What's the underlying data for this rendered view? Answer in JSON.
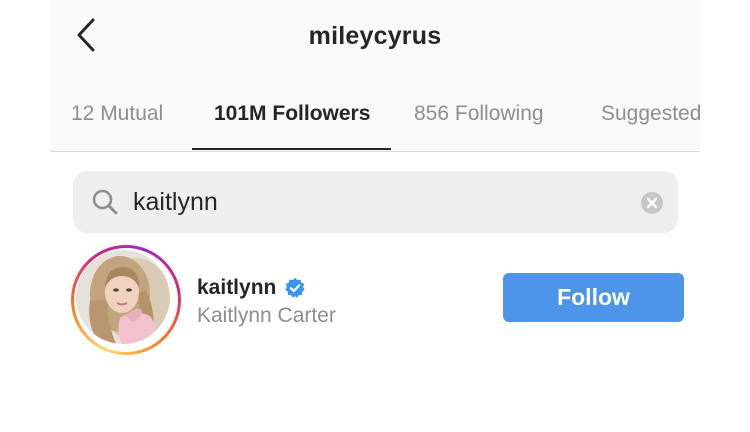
{
  "header": {
    "title": "mileycyrus",
    "back_icon": "chevron-left-icon"
  },
  "tabs": [
    {
      "label": "12 Mutual",
      "active": false
    },
    {
      "label": "101M Followers",
      "active": true
    },
    {
      "label": "856 Following",
      "active": false
    },
    {
      "label": "Suggested",
      "active": false
    }
  ],
  "search": {
    "value": "kaitlynn",
    "icon": "search-icon",
    "clear_icon": "clear-icon"
  },
  "results": [
    {
      "username": "kaitlynn",
      "full_name": "Kaitlynn Carter",
      "verified": true,
      "follow_label": "Follow"
    }
  ],
  "colors": {
    "follow_button": "#4c95e8",
    "verified_badge": "#3897f0",
    "primary_text": "#262626",
    "secondary_text": "#8e8e8e",
    "header_background": "#fafafa",
    "search_background": "#efefef"
  }
}
